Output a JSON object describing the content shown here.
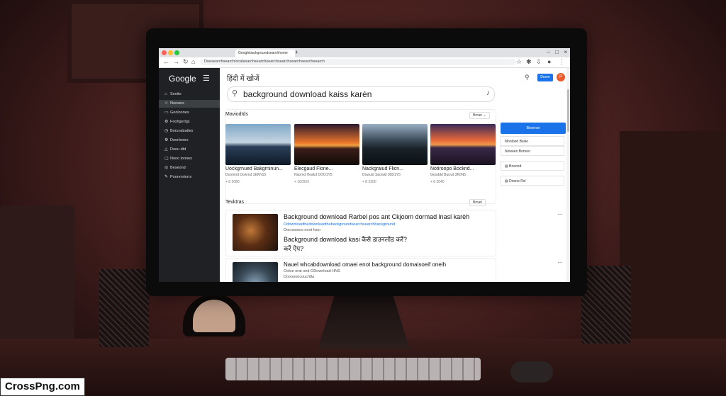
{
  "browser": {
    "tab_title": "Googlebackgroundsearchhome",
    "address": "Duesearchsearchlocalsearchsearchsearchsearchsearchsearchsearch",
    "colors": {
      "close": "#ff5f57",
      "min": "#febc2e",
      "max": "#28c840"
    }
  },
  "sidebar": {
    "logo": "Google",
    "items": [
      {
        "label": "Sooito",
        "icon": "home-icon"
      },
      {
        "label": "Noowes",
        "icon": "star-icon"
      },
      {
        "label": "Gooloones",
        "icon": "chat-icon"
      },
      {
        "label": "Foohgerlgs",
        "icon": "gear-icon"
      },
      {
        "label": "Borunsbattes",
        "icon": "clock-icon"
      },
      {
        "label": "Doorbenrs",
        "icon": "settings-icon"
      },
      {
        "label": "Doou dtd",
        "icon": "triangle-icon"
      },
      {
        "label": "Nooo loones",
        "icon": "box-icon"
      },
      {
        "label": "Beseond",
        "icon": "circle-icon"
      },
      {
        "label": "Poorenriorrs",
        "icon": "pen-icon"
      }
    ]
  },
  "main": {
    "page_title": "हिंदी में खोजें",
    "query": "background download kaiss karèn",
    "top_button": "Doore",
    "avatar": "P",
    "images_section": {
      "title": "Maviodtds",
      "filter": "Bman",
      "items": [
        {
          "title": "Uockgrnued Bakgrninun...",
          "subtitle": "Doomnd Dowmd 1EKN15",
          "meta": "+ 8 2080"
        },
        {
          "title": "Elecgaud Flone...",
          "subtitle": "Naomd Hoakd DOO1Y5",
          "meta": "+ 10/20/2"
        },
        {
          "title": "Nackgraiud Flicn...",
          "subtitle": "Dowuid Saowid 30D1Y5",
          "meta": "+ 8 2300"
        },
        {
          "title": "Notiroopo Bocknd...",
          "subtitle": "Gooddd Buuvd 3K0N5",
          "meta": "+ 8 2040"
        }
      ]
    },
    "results_section": {
      "title": "Tevktras",
      "filter": "Bmari",
      "results": [
        {
          "title": "Background download Rarbel pos ant Ckjoom dormad lnasl karèh",
          "url": "Odownloadthedownloadthebackgroundsearchsearchbackground",
          "meta": "Docnoooos noot hsor",
          "line2": "Background download kasi कैसे डाउनलोड करें?",
          "line3": "करें ऐप?"
        },
        {
          "title": "Nauel whcabdownload omaei enot background domaisoeif oneih",
          "meta": "Ooloe orat oed ODownload HNS",
          "url": "Doooooocouch8a"
        }
      ]
    },
    "right_panel": {
      "button": "Boonoe",
      "items": [
        "Mooloed Bsaio",
        "Noweeo Borneo",
        "Boeond",
        "Doone Rsi"
      ]
    }
  },
  "watermark": "CrossPng.com"
}
